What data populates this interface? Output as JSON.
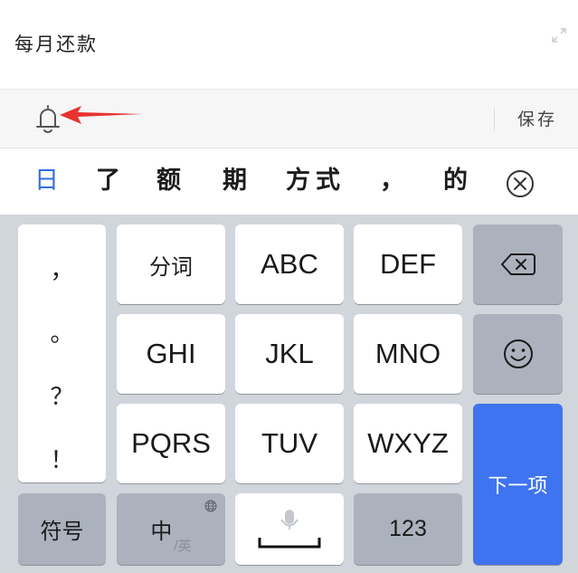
{
  "note": {
    "title": "每月还款"
  },
  "toolbar": {
    "save_label": "保存"
  },
  "candidates": [
    "日",
    "了",
    "额",
    "期",
    "方式",
    "，",
    "的"
  ],
  "keyboard": {
    "punctuation": [
      "，",
      "。",
      "？",
      "！"
    ],
    "keys": {
      "fenci": "分词",
      "abc": "ABC",
      "def": "DEF",
      "ghi": "GHI",
      "jkl": "JKL",
      "mno": "MNO",
      "pqrs": "PQRS",
      "tuv": "TUV",
      "wxyz": "WXYZ",
      "symbols": "符号",
      "lang_main": "中",
      "lang_alt": "/英",
      "num": "123",
      "next": "下一项"
    }
  },
  "colors": {
    "accent_blue": "#3f74f0",
    "candidate_highlight": "#2f6de8",
    "annotation_arrow": "#e8332f",
    "keyboard_bg": "#d1d5dc"
  }
}
